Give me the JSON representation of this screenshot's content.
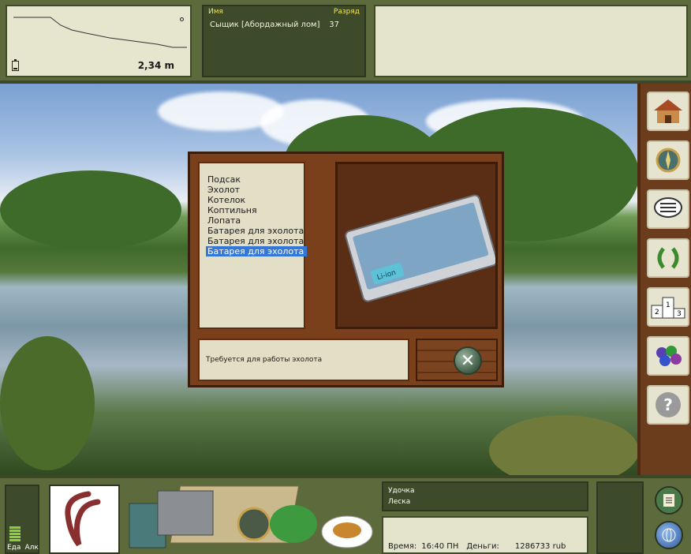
{
  "depth": {
    "value": "2,34 m"
  },
  "players": {
    "header_name": "Имя",
    "header_rank": "Разряд",
    "rows": [
      {
        "name": "Сыщик [Абордажный лом]",
        "rank": "37"
      }
    ]
  },
  "dialog": {
    "items": [
      "Подсак",
      "Эхолот",
      "Котелок",
      "Коптильня",
      "Лопата",
      "Батарея для эхолота",
      "Батарея для эхолота",
      "Батарея для эхолота"
    ],
    "selected_index": 7,
    "description": "Требуется для работы эхолота",
    "close_symbol": "✕",
    "image": {
      "battery_label": "Li-ion"
    }
  },
  "sidebar": {
    "buttons": [
      "house-icon",
      "compass-icon",
      "chat-icon",
      "laurel-icon",
      "podium-icon",
      "grapes-icon",
      "help-icon"
    ],
    "podium": [
      "1",
      "2",
      "3"
    ],
    "help_symbol": "?"
  },
  "bottom": {
    "eat_label": "Еда",
    "alc_label": "Алк",
    "rod_label": "Удочка",
    "line_label": "Леска",
    "time_label": "Время:",
    "time_value": "16:40 ПН",
    "money_label": "Деньги:",
    "money_value": "1286733 rub"
  },
  "colors": {
    "selected": "#3378d9",
    "panel_light": "#e2dfc6",
    "wood": "#7a3f1b",
    "frame_green": "#5d6b3c"
  }
}
